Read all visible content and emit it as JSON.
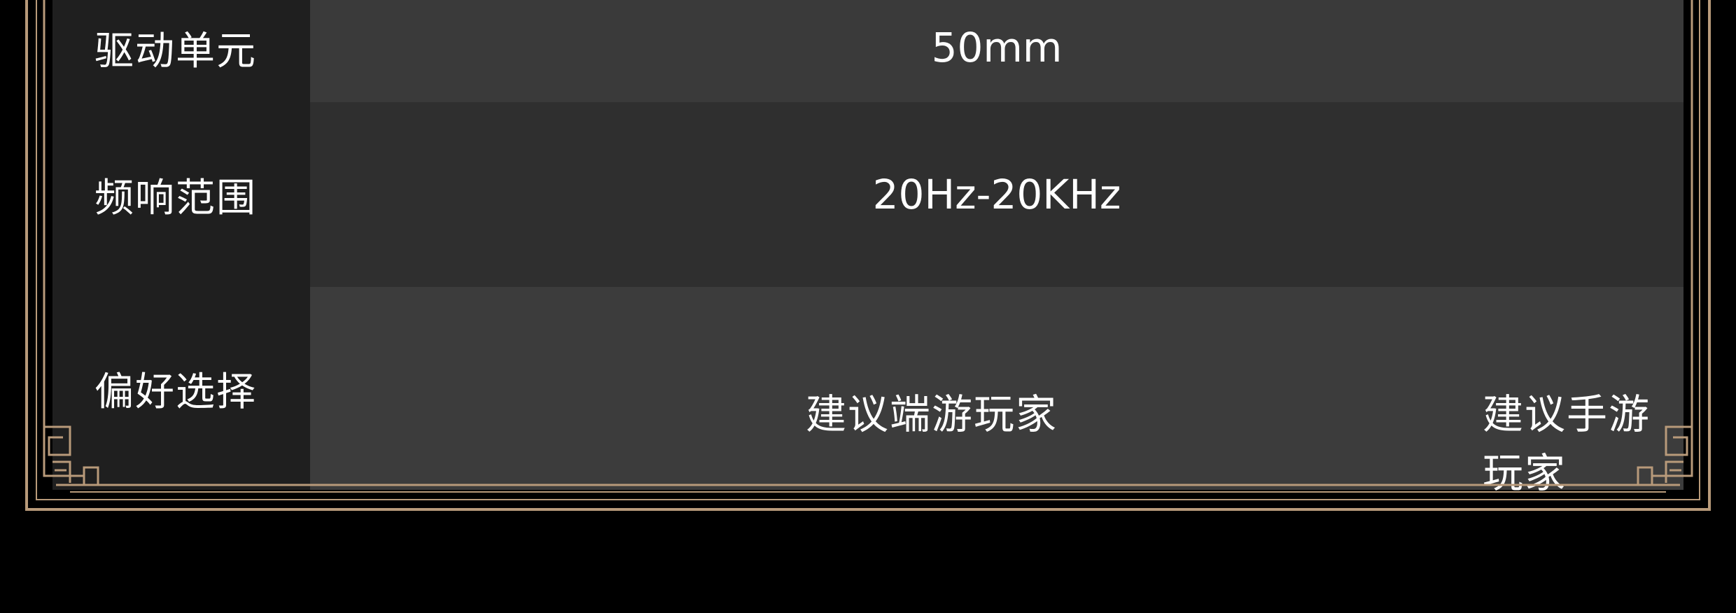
{
  "spec_table": {
    "rows": [
      {
        "label": "驱动单元",
        "value": "50mm"
      },
      {
        "label": "频响范围",
        "value": "20Hz-20KHz"
      },
      {
        "label": "偏好选择",
        "value_a": "建议端游玩家",
        "value_b": "建议手游玩家"
      }
    ]
  },
  "colors": {
    "background": "#000000",
    "label_cell": "#1f1f1f",
    "value_cell": "#3a3a3a",
    "frame_gold": "#b89a7a",
    "text": "#ffffff"
  }
}
